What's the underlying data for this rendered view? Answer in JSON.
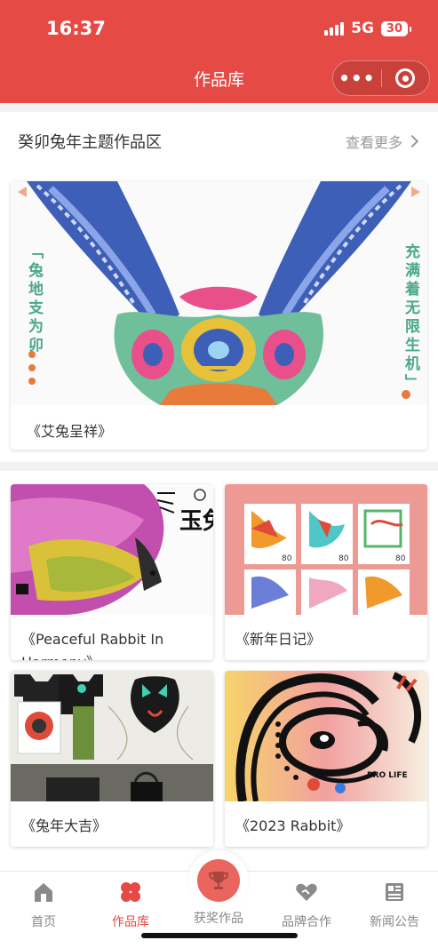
{
  "status": {
    "time": "16:37",
    "network": "5G",
    "battery": "30"
  },
  "nav": {
    "title": "作品库"
  },
  "section": {
    "title": "癸卯兔年主题作品区",
    "more": "查看更多",
    "featured": {
      "caption": "《艾兔呈祥》",
      "left_text": "「兔地支为卯",
      "right_text": "充满着无限生机」"
    }
  },
  "works": [
    {
      "caption": "《Peaceful Rabbit In Harmony》",
      "art_text": "玉兔"
    },
    {
      "caption": "《新年日记》",
      "stamp_value": "80"
    },
    {
      "caption": "《兔年大吉》"
    },
    {
      "caption": "《2023 Rabbit》",
      "art_text": "PRO LIFE"
    }
  ],
  "tabbar": {
    "items": [
      {
        "label": "首页",
        "icon": "home-icon"
      },
      {
        "label": "作品库",
        "icon": "clover-icon",
        "active": true
      },
      {
        "label": "获奖作品",
        "icon": "trophy-icon"
      },
      {
        "label": "品牌合作",
        "icon": "handshake-heart-icon"
      },
      {
        "label": "新闻公告",
        "icon": "newspaper-icon"
      }
    ]
  },
  "colors": {
    "primary": "#e64a44",
    "accent_green": "#4aa88c"
  }
}
